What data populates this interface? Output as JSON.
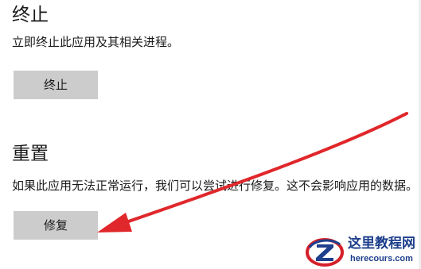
{
  "terminate": {
    "title": "终止",
    "description": "立即终止此应用及其相关进程。",
    "button_label": "终止"
  },
  "reset": {
    "title": "重置",
    "description": "如果此应用无法正常运行，我们可以尝试进行修复。这不会影响应用的数据。",
    "button_label": "修复"
  },
  "annotation": {
    "arrow_color": "#e0272b",
    "arrow_target": "repair-button"
  },
  "watermark": {
    "logo_icon": "z-logo-icon",
    "site_name": "这里教程网",
    "url": "herecours.com",
    "colors": {
      "primary": "#1d3f8c",
      "accent": "#d4202a"
    }
  },
  "colors": {
    "button_bg": "#cccccc",
    "text": "#1a1a1a",
    "background": "#ffffff"
  }
}
